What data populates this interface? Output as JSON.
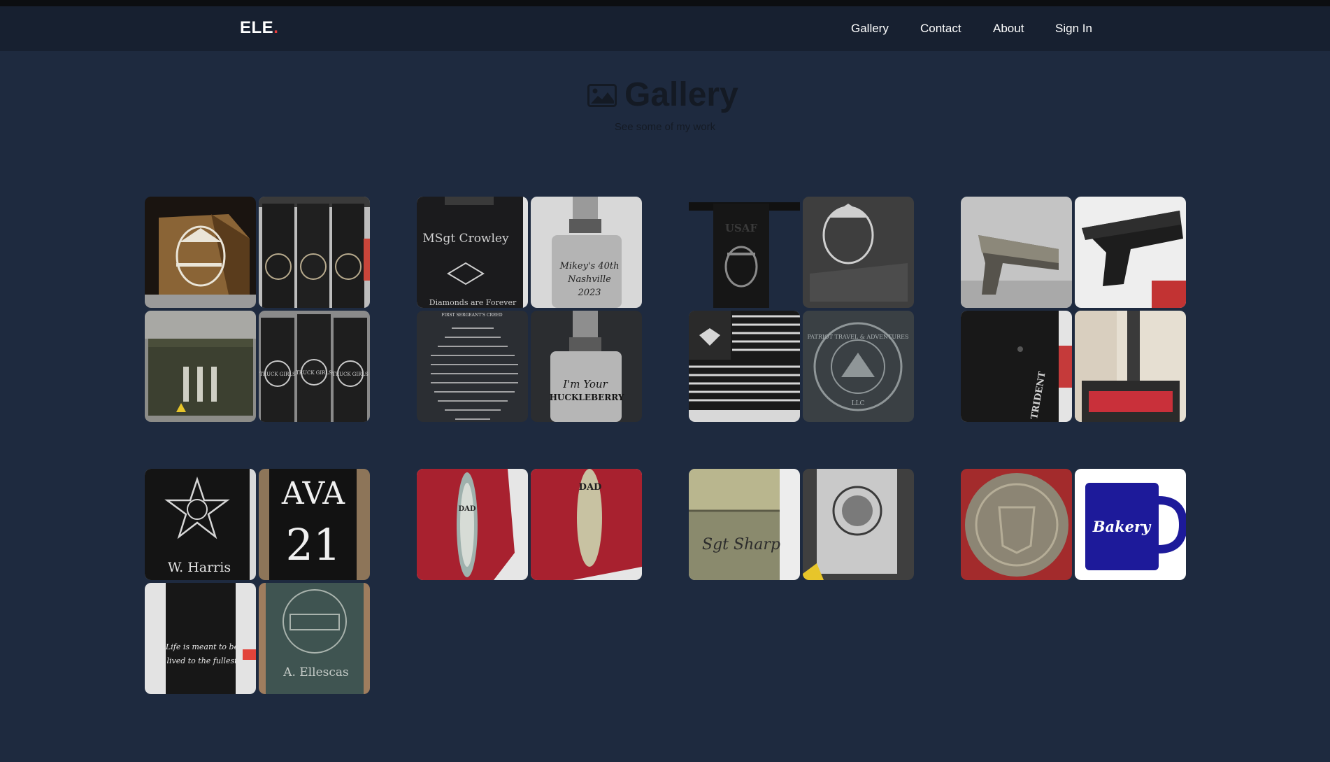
{
  "nav": {
    "brand": "ELE",
    "brand_dot": ".",
    "links": [
      "Gallery",
      "Contact",
      "About",
      "Sign In"
    ]
  },
  "hero": {
    "icon": "image-icon",
    "title": "Gallery",
    "subtitle": "See some of my work"
  },
  "gallery": {
    "photo_text": {
      "flask_name": "MSgt Crowley",
      "flask_motto": "Diamonds are Forever",
      "flask2_line1": "Mikey's 40th",
      "flask2_line2": "Nashville",
      "flask2_line3": "2023",
      "letter_heading": "FIRST SERGEANT'S CREED",
      "flask3_line1": "I'm Your",
      "flask3_line2": "HUCKLEBERRY",
      "mag_brand": "USAF",
      "patriot_top": "PATRIOT TRAVEL & ADVENTURES",
      "patriot_bottom": "LLC",
      "glock_brand": "TRIDENT",
      "mag_line": "TRUCK GIRLS",
      "badge_name": "W. Harris",
      "ava_top": "AVA",
      "ava_num": "21",
      "tumbler_script1": "Life is meant to be",
      "tumbler_script2": "lived to the fullest",
      "tumbler_name": "A. Ellescas",
      "lure1": "DAD",
      "lure2": "DAD",
      "lighter_name": "Sgt Sharp",
      "mug_brand": "Bakery"
    }
  }
}
